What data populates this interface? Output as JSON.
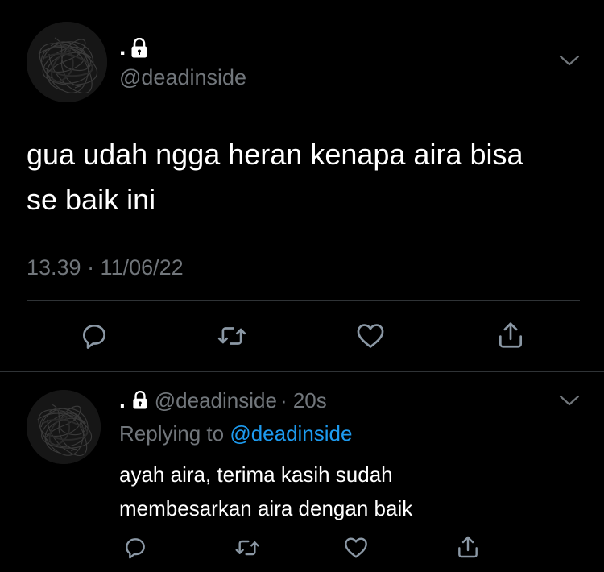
{
  "colors": {
    "background": "#000000",
    "text": "#ffffff",
    "muted": "#71767b",
    "link": "#1d9bf0",
    "divider": "#2f3336"
  },
  "main_tweet": {
    "display_name": ".",
    "handle": "@deadinside",
    "text_line1": "gua udah ngga heran kenapa aira bisa",
    "text_line2": "se baik ini",
    "timestamp": "13.39 · 11/06/22",
    "icons": [
      "lock-icon",
      "chevron-down-icon",
      "reply-icon",
      "retweet-icon",
      "like-icon",
      "share-icon"
    ]
  },
  "reply_tweet": {
    "display_name": ".",
    "handle": "@deadinside",
    "age": "· 20s",
    "replying_label": "Replying to",
    "replying_handle": "@deadinside",
    "text_line1": "ayah aira, terima kasih sudah",
    "text_line2": "membesarkan aira dengan baik",
    "icons": [
      "lock-icon",
      "chevron-down-icon",
      "reply-icon",
      "retweet-icon",
      "like-icon",
      "share-icon"
    ]
  }
}
